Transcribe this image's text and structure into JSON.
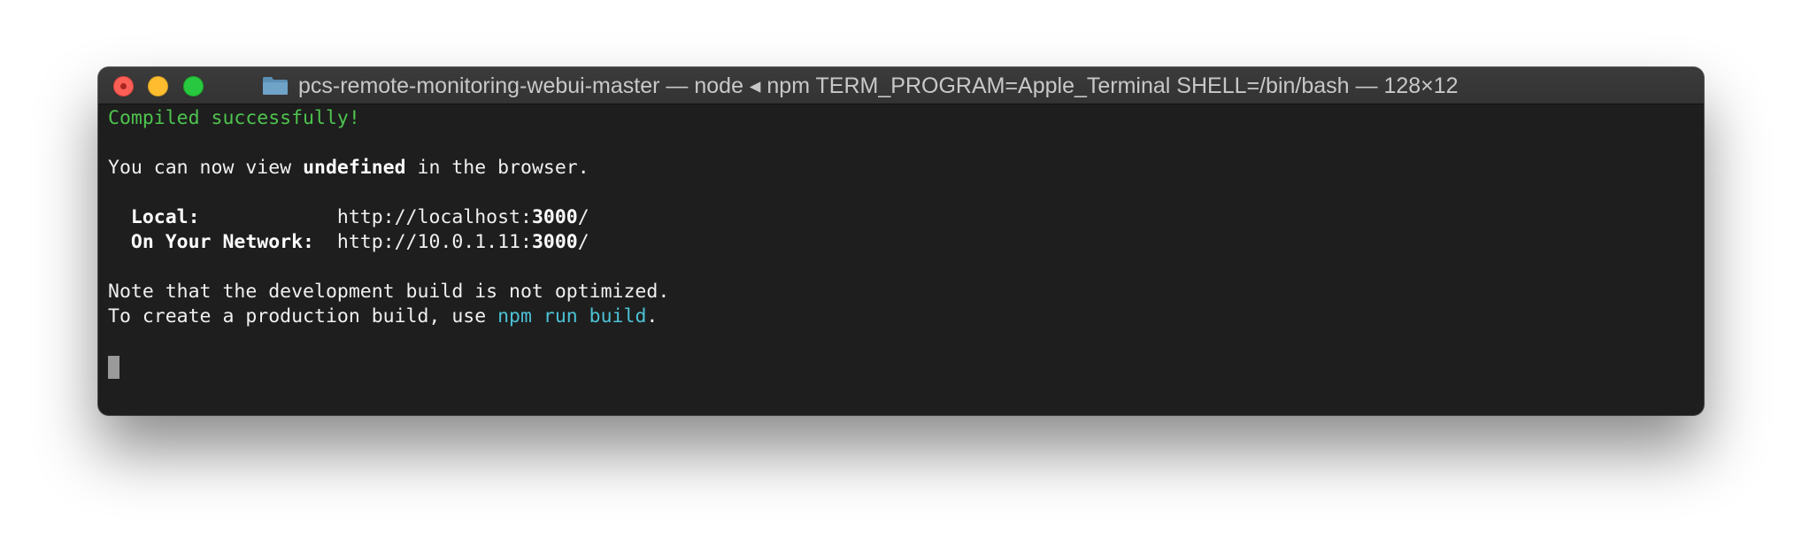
{
  "window": {
    "title": "pcs-remote-monitoring-webui-master — node ◂ npm TERM_PROGRAM=Apple_Terminal SHELL=/bin/bash — 128×12"
  },
  "terminal": {
    "compiled": "Compiled successfully!",
    "view_prefix": "You can now view ",
    "view_app": "undefined",
    "view_suffix": " in the browser.",
    "local_label": "  Local:            ",
    "local_url_prefix": "http://localhost:",
    "local_port": "3000",
    "local_url_suffix": "/",
    "network_label": "  On Your Network:  ",
    "network_url_prefix": "http://10.0.1.11:",
    "network_port": "3000",
    "network_url_suffix": "/",
    "note": "Note that the development build is not optimized.",
    "prod_prefix": "To create a production build, use ",
    "prod_command": "npm run build",
    "prod_suffix": "."
  },
  "colors": {
    "success": "#4ec44e",
    "command": "#4cc2d6",
    "background": "#1e1e1e"
  }
}
